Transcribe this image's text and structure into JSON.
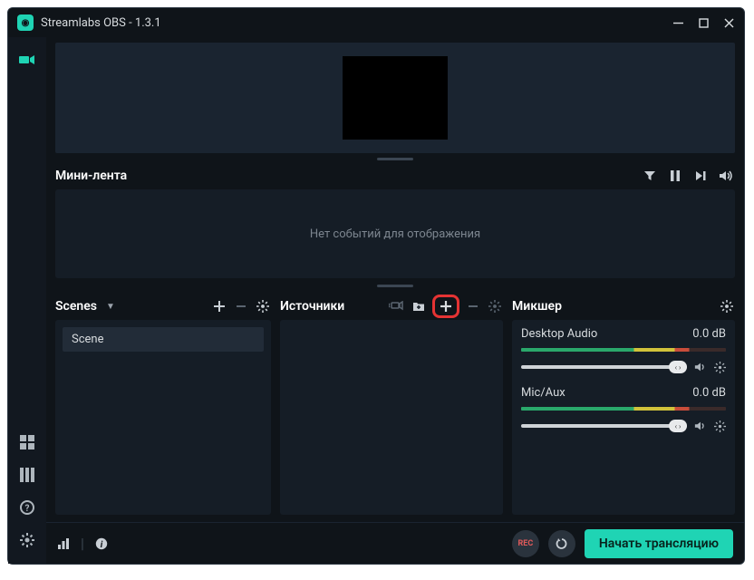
{
  "title": "Streamlabs OBS - 1.3.1",
  "feed": {
    "title": "Мини-лента",
    "empty": "Нет событий для отображения"
  },
  "scenes": {
    "title": "Scenes",
    "items": [
      "Scene"
    ]
  },
  "sources": {
    "title": "Источники"
  },
  "mixer": {
    "title": "Микшер",
    "channels": [
      {
        "name": "Desktop Audio",
        "level": "0.0 dB"
      },
      {
        "name": "Mic/Aux",
        "level": "0.0 dB"
      }
    ]
  },
  "footer": {
    "rec": "REC",
    "start": "Начать трансляцию"
  }
}
